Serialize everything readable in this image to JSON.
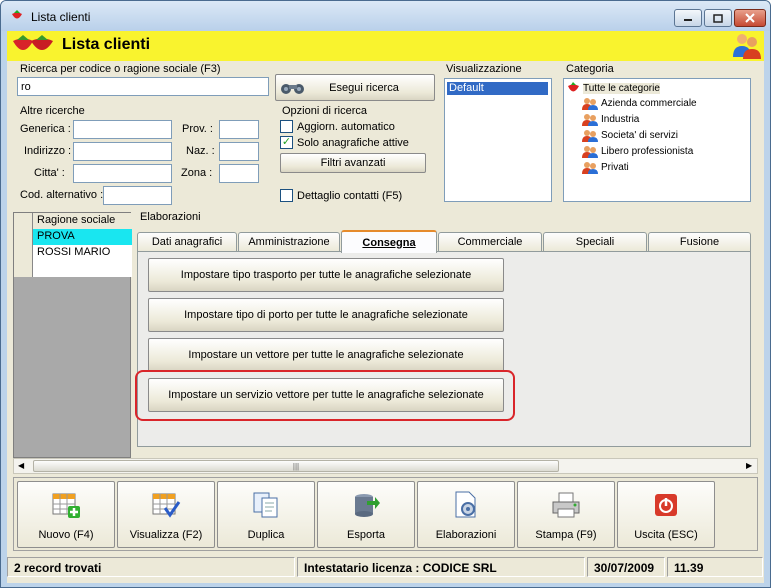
{
  "window": {
    "title": "Lista clienti"
  },
  "header": {
    "title": "Lista clienti"
  },
  "search": {
    "label": "Ricerca per codice o ragione sociale (F3)",
    "value": "ro",
    "button": "Esegui ricerca"
  },
  "other_searches": {
    "label": "Altre ricerche",
    "generica": "Generica :",
    "indirizzo": "Indirizzo :",
    "citta": "Citta' :",
    "cod_alternativo": "Cod. alternativo :",
    "prov": "Prov. :",
    "naz": "Naz. :",
    "zona": "Zona :"
  },
  "search_options": {
    "label": "Opzioni di ricerca",
    "aggiorn": "Aggiorn. automatico",
    "solo": "Solo anagrafiche attive",
    "filtri": "Filtri avanzati",
    "dettaglio": "Dettaglio contatti (F5)"
  },
  "visualizzazione": {
    "label": "Visualizzazione",
    "items": [
      "Default"
    ]
  },
  "categoria": {
    "label": "Categoria",
    "root": "Tutte le categorie",
    "items": [
      "Azienda commerciale",
      "Industria",
      "Societa' di servizi",
      "Libero professionista",
      "Privati"
    ]
  },
  "grid": {
    "header": "Ragione sociale",
    "rows": [
      "PROVA",
      "ROSSI MARIO"
    ]
  },
  "elaborazioni": {
    "label": "Elaborazioni",
    "tabs": [
      "Dati anagrafici",
      "Amministrazione",
      "Consegna",
      "Commerciale",
      "Speciali",
      "Fusione"
    ],
    "buttons": [
      "Impostare tipo trasporto per tutte le anagrafiche selezionate",
      "Impostare tipo di porto per tutte le anagrafiche selezionate",
      "Impostare un vettore per tutte le anagrafiche selezionate",
      "Impostare un servizio vettore per tutte le anagrafiche selezionate"
    ]
  },
  "toolbar": {
    "nuovo": "Nuovo (F4)",
    "visualizza": "Visualizza (F2)",
    "duplica": "Duplica",
    "esporta": "Esporta",
    "elaborazioni": "Elaborazioni",
    "stampa": "Stampa (F9)",
    "uscita": "Uscita (ESC)"
  },
  "status": {
    "records": "2 record trovati",
    "licenza": "Intestatario licenza : CODICE SRL",
    "date": "30/07/2009",
    "time": "11.39"
  },
  "colors": {
    "header_bg": "#f9f32e",
    "selected_row": "#19e6f0",
    "highlight": "#d9252a"
  }
}
